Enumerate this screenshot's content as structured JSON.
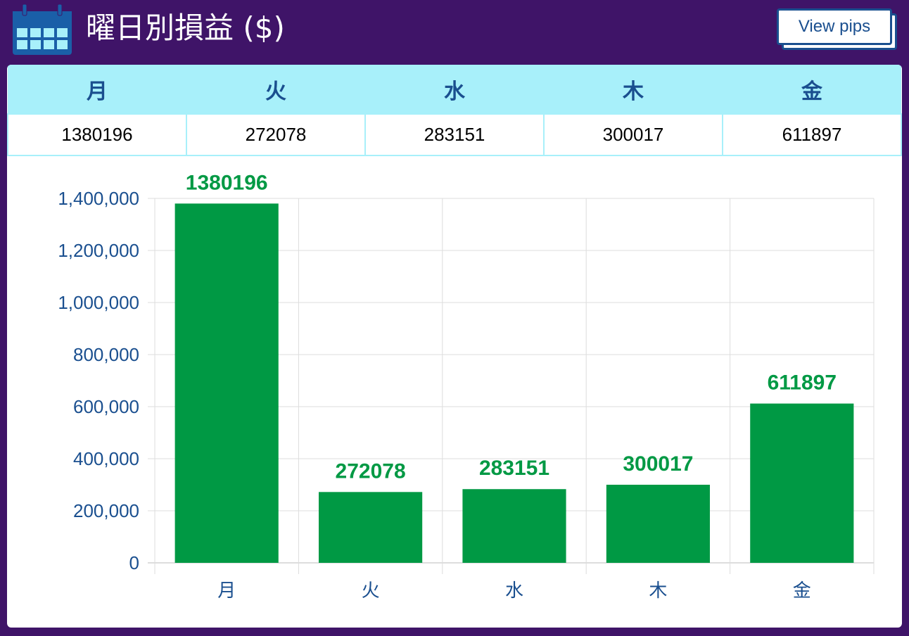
{
  "header": {
    "title": "曜日別損益 ($)",
    "view_button_label": "View pips",
    "icon": "calendar-icon"
  },
  "colors": {
    "background": "#3f1468",
    "bar": "#009944",
    "bar_label": "#009944",
    "axis_text": "#1a4f8f",
    "table_header_bg": "#a8f0fa",
    "table_header_text": "#1a4f8f"
  },
  "summary_table": {
    "headers": [
      "月",
      "火",
      "水",
      "木",
      "金"
    ],
    "values": [
      "1380196",
      "272078",
      "283151",
      "300017",
      "611897"
    ]
  },
  "chart_data": {
    "type": "bar",
    "categories": [
      "月",
      "火",
      "水",
      "木",
      "金"
    ],
    "values": [
      1380196,
      272078,
      283151,
      300017,
      611897
    ],
    "data_labels": [
      "1380196",
      "272078",
      "283151",
      "300017",
      "611897"
    ],
    "title": "",
    "xlabel": "",
    "ylabel": "",
    "ylim": [
      0,
      1400000
    ],
    "yticks": [
      0,
      200000,
      400000,
      600000,
      800000,
      1000000,
      1200000,
      1400000
    ],
    "ytick_labels": [
      "0",
      "200,000",
      "400,000",
      "600,000",
      "800,000",
      "1,000,000",
      "1,200,000",
      "1,400,000"
    ],
    "grid": true,
    "legend": false
  }
}
